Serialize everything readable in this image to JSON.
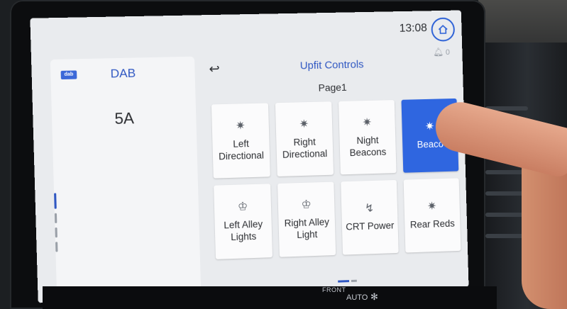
{
  "status": {
    "clock": "13:08",
    "notifications": "0"
  },
  "audio": {
    "source": "DAB",
    "logo_text": "dab",
    "station": "5A"
  },
  "upfit": {
    "title": "Upfit Controls",
    "page": "Page1",
    "tiles": [
      {
        "label_line1": "Left",
        "label_line2": "Directional",
        "icon": "beacon-icon",
        "active": false
      },
      {
        "label_line1": "Right",
        "label_line2": "Directional",
        "icon": "beacon-icon",
        "active": false
      },
      {
        "label_line1": "Night",
        "label_line2": "Beacons",
        "icon": "beacon-icon",
        "active": false
      },
      {
        "label_line1": "Beaco",
        "label_line2": "",
        "icon": "beacon-icon",
        "active": true
      },
      {
        "label_line1": "Left Alley",
        "label_line2": "Lights",
        "icon": "alley-light-icon",
        "active": false
      },
      {
        "label_line1": "Right Alley",
        "label_line2": "Light",
        "icon": "alley-light-icon",
        "active": false
      },
      {
        "label_line1": "CRT Power",
        "label_line2": "",
        "icon": "power-icon",
        "active": false
      },
      {
        "label_line1": "Rear Reds",
        "label_line2": "",
        "icon": "beacon-icon",
        "active": false
      }
    ]
  },
  "climate": {
    "front_label": "FRONT",
    "auto_label": "AUTO"
  },
  "colors": {
    "accent": "#2f57c2",
    "active_tile": "#2f66e0",
    "screen_bg": "#e9ebee"
  }
}
